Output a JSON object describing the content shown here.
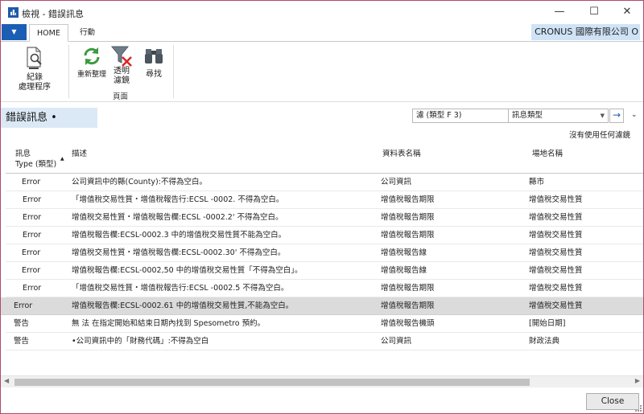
{
  "window": {
    "title": "檢視 - 錯誤訊息",
    "minimize": "—",
    "maximize": "☐",
    "close": "✕"
  },
  "tabs": {
    "file": "▼",
    "home": "HOME",
    "actions": "行動"
  },
  "company": "CRONUS 國際有限公司 O",
  "ribbon": {
    "record_line1": "紀錄",
    "record_line2": "處理程序",
    "refresh": "重新整理",
    "clear_line1": "透明",
    "clear_line2": "濾鏡",
    "find": "尋找",
    "group_page": "頁面"
  },
  "page": {
    "title": "錯誤訊息 •",
    "filter_value": "濾 (類型 F 3)",
    "filter_field": "訊息類型",
    "filter_caret": "▼",
    "go": "→",
    "collapse": "⌄",
    "no_filter": "沒有使用任何濾鏡"
  },
  "columns": {
    "type_line1": "訊息",
    "type_line2": "Type (類型)",
    "sort": "▲",
    "description": "描述",
    "table_name": "資料表名稱",
    "field_name": "場地名稱"
  },
  "rows": [
    {
      "type": "Error",
      "description": "公司資訊中的縣(County):不得為空白。",
      "table": "公司資訊",
      "field": "縣市"
    },
    {
      "type": "Error",
      "description": "「增值稅交易性質・增值稅報告行:ECSL -0002. 不得為空白。",
      "table": "增值稅報告期限",
      "field": "增值稅交易性質"
    },
    {
      "type": "Error",
      "description": "增值稅交易性質・增值稅報告欄:ECSL -0002.2' 不得為空白。",
      "table": "增值稅報告期限",
      "field": "增值稅交易性質"
    },
    {
      "type": "Error",
      "description": "增值稅報告欄:ECSL-0002.3 中的增值稅交易性質不能為空白。",
      "table": "增值稅報告期限",
      "field": "增值稅交易性質"
    },
    {
      "type": "Error",
      "description": "增值稅交易性質・增值稅報告欄:ECSL-0002.30' 不得為空白。",
      "table": "增值稅報告線",
      "field": "增值稅交易性質"
    },
    {
      "type": "Error",
      "description": "增值稅報告欄:ECSL-0002,50 中的增值稅交易性質「不得為空白」。",
      "table": "增值稅報告線",
      "field": "增值稅交易性質"
    },
    {
      "type": "Error",
      "description": "「增值稅交易性質・增值稅報告行:ECSL -0002.5 不得為空白。",
      "table": "增值稅報告期限",
      "field": "增值稅交易性質"
    },
    {
      "type": "Error",
      "description": "增值稅報告欄:ECSL-0002.61 中的增值稅交易性質,不能為空白。",
      "table": "增值稅報告期限",
      "field": "增值稅交易性質"
    },
    {
      "type": "警告",
      "description": "無 法 在指定開始和結束日期內找到 Spesometro 預約。",
      "table": "增值稅報告機頭",
      "field": "[開始日期]"
    },
    {
      "type": "警告",
      "description": "•公司資訊中的「財務代碼」:不得為空白",
      "table": "公司資訊",
      "field": "財政法典"
    }
  ],
  "scroll": {
    "left": "◀",
    "right": "▶"
  },
  "footer": {
    "close": "Close"
  },
  "colors": {
    "accent": "#1a5fb4",
    "selected_row": "#dbdbdb",
    "company_bg": "#cfe3f7",
    "page_title_bg": "#dbe9f6"
  }
}
